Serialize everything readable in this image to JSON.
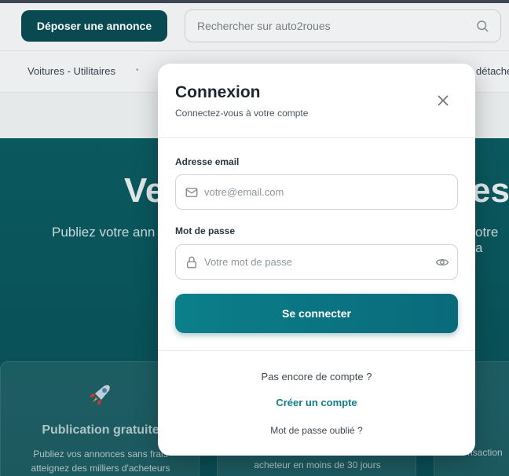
{
  "header": {
    "post_button": "Déposer une annonce",
    "search_placeholder": "Rechercher sur auto2roues"
  },
  "categories": {
    "left": "Voitures - Utilitaires",
    "separator": "•",
    "right": "détaché"
  },
  "hero": {
    "title_left": "Ve",
    "title_right": "es",
    "subtitle_left": "Publiez votre ann",
    "subtitle_right": "otre a"
  },
  "cards": [
    {
      "icon": "rocket-icon",
      "title": "Publication gratuite",
      "desc_line1": "Publiez vos annonces sans frais",
      "desc_line2": "atteignez des milliers d'acheteurs"
    },
    {
      "desc": "acheteur en moins de 30 jours"
    },
    {
      "desc": "nsaction"
    }
  ],
  "modal": {
    "title": "Connexion",
    "subtitle": "Connectez-vous à votre compte",
    "email_label": "Adresse email",
    "email_placeholder": "votre@email.com",
    "password_label": "Mot de passe",
    "password_placeholder": "Votre mot de passe",
    "submit_label": "Se connecter",
    "no_account": "Pas encore de compte ?",
    "create_account": "Créer un compte",
    "forgot_password": "Mot de passe oublié ?"
  },
  "colors": {
    "brand_dark": "#0a4d55",
    "brand_accent": "#0b7f8a",
    "link": "#127c88"
  }
}
